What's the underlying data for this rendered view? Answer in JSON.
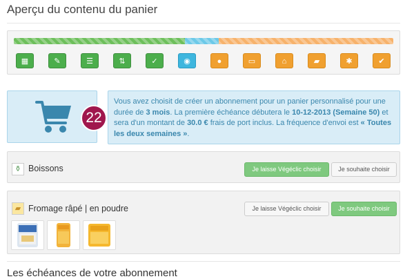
{
  "page": {
    "title": "Aperçu du contenu du panier"
  },
  "steps": [
    {
      "icon": "grid-icon",
      "glyph": "▦",
      "state": "done"
    },
    {
      "icon": "wrench-icon",
      "glyph": "✎",
      "state": "done"
    },
    {
      "icon": "list-icon",
      "glyph": "☰",
      "state": "done"
    },
    {
      "icon": "sort-icon",
      "glyph": "⇅",
      "state": "done"
    },
    {
      "icon": "check-circle-icon",
      "glyph": "✓",
      "state": "done"
    },
    {
      "icon": "eye-icon",
      "glyph": "◉",
      "state": "current"
    },
    {
      "icon": "user-icon",
      "glyph": "●",
      "state": "todo"
    },
    {
      "icon": "credit-card-icon",
      "glyph": "▭",
      "state": "todo"
    },
    {
      "icon": "home-icon",
      "glyph": "⌂",
      "state": "todo"
    },
    {
      "icon": "comment-icon",
      "glyph": "▰",
      "state": "todo"
    },
    {
      "icon": "asterisk-icon",
      "glyph": "✱",
      "state": "todo"
    },
    {
      "icon": "check-square-icon",
      "glyph": "✔",
      "state": "todo"
    }
  ],
  "progress": {
    "done_fraction": 0.45,
    "current_fraction": 0.09,
    "remaining_fraction": 0.46,
    "colors": {
      "done": "#6dbf5b",
      "current": "#6cc9e8",
      "remaining": "#f7b26b"
    }
  },
  "cart": {
    "count": "22",
    "badge_color": "#a0174d"
  },
  "info": {
    "p1": "Vous avez choisit de créer un abonnement pour un panier personnalisé pour une durée de ",
    "duration": "3 mois",
    "p2": ". La première échéance débutera le ",
    "start": "10-12-2013 (Semaine 50)",
    "p3": " et sera d'un montant de ",
    "amount": "30.0 €",
    "p4": " frais de port inclus. La fréquence d'envoi est ",
    "frequency": "« Toutes les deux semaines »",
    "p5": "."
  },
  "products": [
    {
      "name": "Boissons",
      "choice_vegeclic": "Je laisse Végéclic choisir",
      "choice_self": "Je souhaite choisir",
      "selected": "vegeclic"
    },
    {
      "name": "Fromage râpé | en poudre",
      "choice_vegeclic": "Je laisse Végéclic choisir",
      "choice_self": "Je souhaite choisir",
      "selected": "self"
    }
  ],
  "schedule": {
    "title": "Les échéances de votre abonnement"
  }
}
